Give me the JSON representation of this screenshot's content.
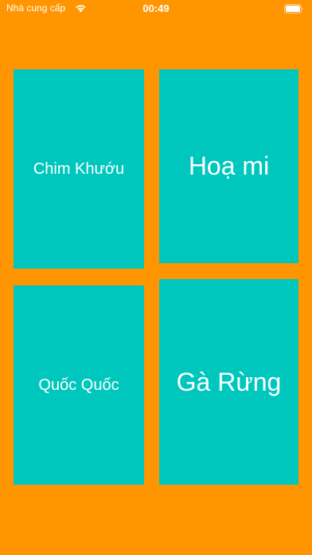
{
  "status_bar": {
    "carrier": "Nhà cung cấp",
    "time": "00:49",
    "wifi_icon": "wifi-icon",
    "battery_icon": "battery-icon"
  },
  "colors": {
    "background": "#FF9500",
    "tile": "#00C7BE",
    "text": "#FFFFFF"
  },
  "tiles": [
    {
      "label": "Chim Khướu"
    },
    {
      "label": "Hoạ mi"
    },
    {
      "label": "Quốc Quốc"
    },
    {
      "label": "Gà Rừng"
    }
  ]
}
